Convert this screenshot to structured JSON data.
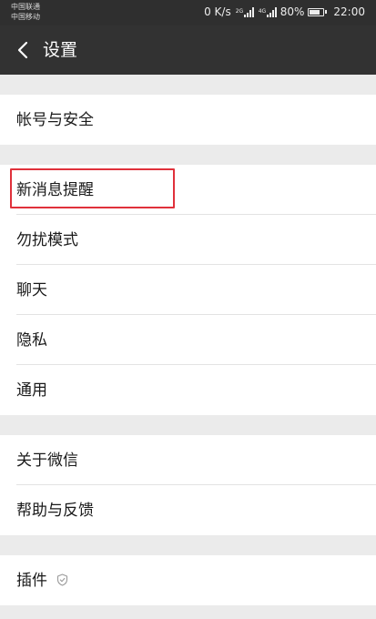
{
  "status_bar": {
    "carrier_1": "中国联通",
    "carrier_2": "中国移动",
    "speed": "0 K/s",
    "signal_1_tag": "2G",
    "signal_2_tag": "4G",
    "battery": "80%",
    "battery_level": 0.8,
    "time": "22:00"
  },
  "header": {
    "title": "设置",
    "back_icon": "chevron-left-icon"
  },
  "sections": [
    {
      "items": [
        {
          "label": "帐号与安全"
        }
      ]
    },
    {
      "items": [
        {
          "label": "新消息提醒",
          "highlighted": true
        },
        {
          "label": "勿扰模式"
        },
        {
          "label": "聊天"
        },
        {
          "label": "隐私"
        },
        {
          "label": "通用"
        }
      ]
    },
    {
      "items": [
        {
          "label": "关于微信"
        },
        {
          "label": "帮助与反馈"
        }
      ]
    },
    {
      "items": [
        {
          "label": "插件",
          "icon": "shield-icon"
        }
      ]
    }
  ],
  "colors": {
    "header_bg": "#323232",
    "page_bg": "#ebebeb",
    "highlight": "#e0313b"
  }
}
